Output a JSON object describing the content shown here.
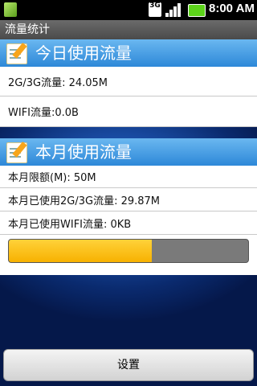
{
  "statusbar": {
    "network_badge": "3G",
    "time": "8:00 AM"
  },
  "titlebar": {
    "title": "流量统计"
  },
  "today": {
    "header": "今日使用流量",
    "mobile_traffic": "2G/3G流量: 24.05M",
    "wifi_traffic": "WIFI流量:0.0B"
  },
  "month": {
    "header": "本月使用流量",
    "limit": "本月限额(M):  50M",
    "used_mobile": "本月已使用2G/3G流量:  29.87M",
    "used_wifi": "本月已使用WIFI流量:  0KB",
    "usage_fraction": 0.597
  },
  "bottom": {
    "settings_label": "设置"
  },
  "colors": {
    "header_blue": "#3b95e2",
    "progress_fill": "#f7b100",
    "progress_track": "#7a7a7a"
  }
}
